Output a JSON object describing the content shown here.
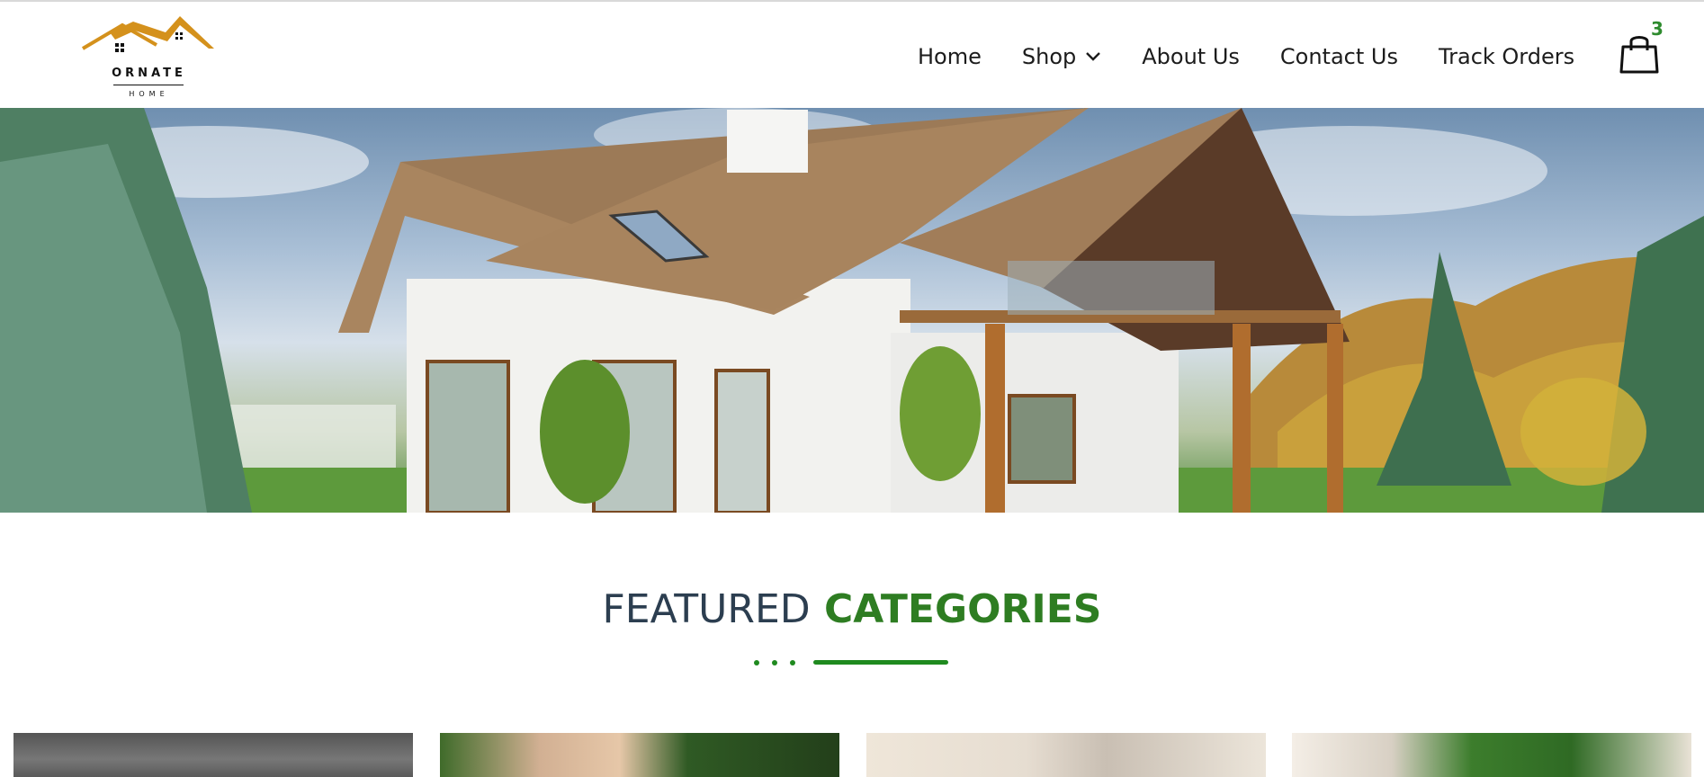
{
  "brand": {
    "name": "ORNATE",
    "tagline": "HOME",
    "logo_color": "#d4911c"
  },
  "nav": {
    "items": [
      {
        "label": "Home"
      },
      {
        "label": "Shop",
        "has_dropdown": true
      },
      {
        "label": "About Us"
      },
      {
        "label": "Contact Us"
      },
      {
        "label": "Track Orders"
      }
    ]
  },
  "cart": {
    "count": "3",
    "icon": "shopping-bag-icon"
  },
  "hero": {
    "image": "house-photo"
  },
  "featured": {
    "title_light": "FEATURED",
    "title_bold": "CATEGORIES"
  },
  "categories": [
    {
      "image": "category-photo-1"
    },
    {
      "image": "category-photo-2"
    },
    {
      "image": "category-photo-3"
    },
    {
      "image": "category-photo-4"
    }
  ],
  "colors": {
    "accent_green": "#2e7d22",
    "divider_green": "#1f8a1f",
    "brand_gold": "#d4911c"
  }
}
